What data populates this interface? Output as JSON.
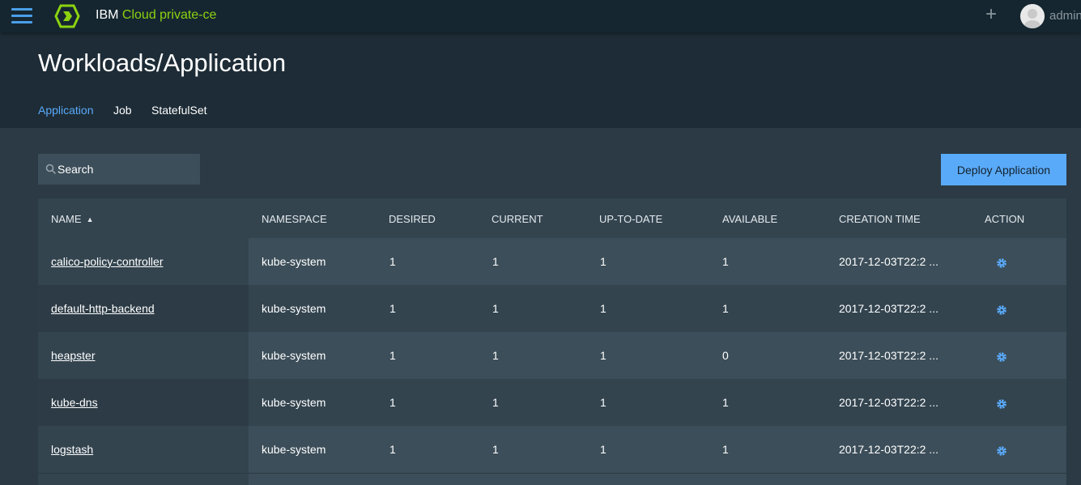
{
  "topbar": {
    "brand_prefix": "IBM",
    "brand_suffix": "Cloud private-ce",
    "plus_label": "+",
    "user": "admin",
    "colors": {
      "bar": "#152630",
      "accent_green": "#8cd211",
      "accent_blue": "#4a9ee8"
    }
  },
  "header": {
    "title": "Workloads/Application",
    "tabs": [
      {
        "label": "Application",
        "active": true
      },
      {
        "label": "Job",
        "active": false
      },
      {
        "label": "StatefulSet",
        "active": false
      }
    ]
  },
  "toolbar": {
    "search_placeholder": "Search",
    "deploy_label": "Deploy Application"
  },
  "table": {
    "columns": [
      "NAME",
      "NAMESPACE",
      "DESIRED",
      "CURRENT",
      "UP-TO-DATE",
      "AVAILABLE",
      "CREATION TIME",
      "ACTION"
    ],
    "sort_indicator": "▲",
    "rows": [
      {
        "name": "calico-policy-controller",
        "namespace": "kube-system",
        "desired": "1",
        "current": "1",
        "uptodate": "1",
        "available": "1",
        "created": "2017-12-03T22:2 ..."
      },
      {
        "name": "default-http-backend",
        "namespace": "kube-system",
        "desired": "1",
        "current": "1",
        "uptodate": "1",
        "available": "1",
        "created": "2017-12-03T22:2 ..."
      },
      {
        "name": "heapster",
        "namespace": "kube-system",
        "desired": "1",
        "current": "1",
        "uptodate": "1",
        "available": "0",
        "created": "2017-12-03T22:2 ..."
      },
      {
        "name": "kube-dns",
        "namespace": "kube-system",
        "desired": "1",
        "current": "1",
        "uptodate": "1",
        "available": "1",
        "created": "2017-12-03T22:2 ..."
      },
      {
        "name": "logstash",
        "namespace": "kube-system",
        "desired": "1",
        "current": "1",
        "uptodate": "1",
        "available": "1",
        "created": "2017-12-03T22:2 ..."
      }
    ],
    "action_icon": "gear-icon"
  }
}
